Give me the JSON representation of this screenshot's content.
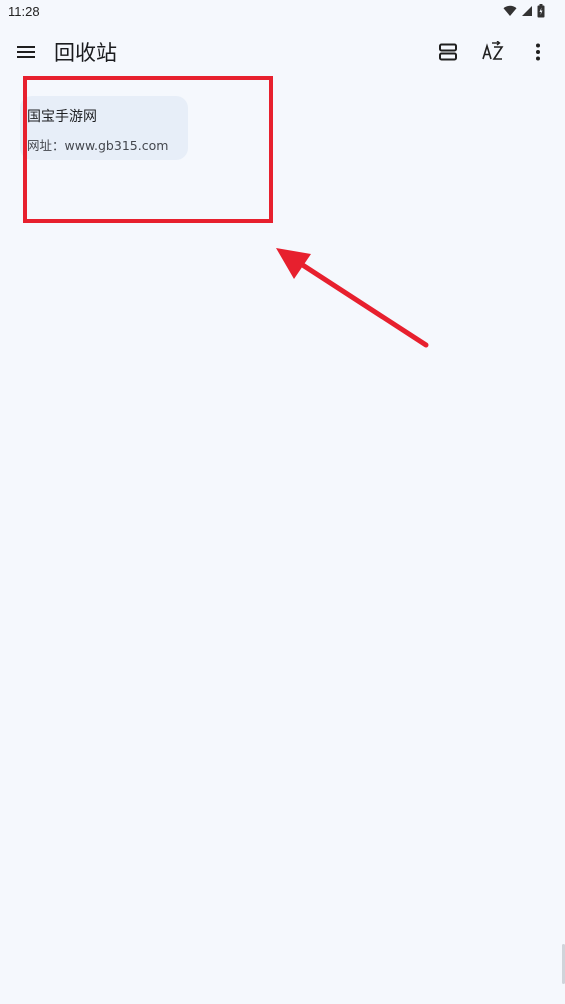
{
  "status_bar": {
    "time": "11:28",
    "icons": [
      "wifi-icon",
      "signal-icon",
      "battery-icon"
    ]
  },
  "app_bar": {
    "title": "回收站",
    "icons": [
      "menu-icon",
      "view-toggle-icon",
      "sort-az-icon",
      "more-vert-icon"
    ]
  },
  "notes": [
    {
      "title": "国宝手游网",
      "body": "网址：www.gb315.com"
    }
  ],
  "annotation": {
    "color": "#e7202e"
  },
  "colors": {
    "background": "#f5f8fd",
    "card": "#e7eef8",
    "accent": "#e7202e"
  }
}
